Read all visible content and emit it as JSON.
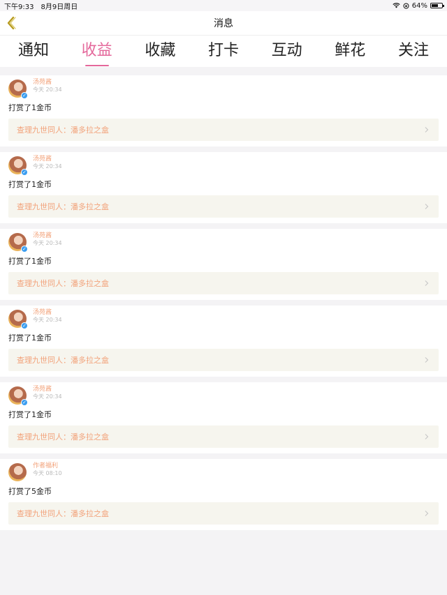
{
  "status": {
    "time": "下午9:33",
    "date": "8月9日周日",
    "battery": "64%",
    "battery_level": 0.64
  },
  "header": {
    "title": "消息",
    "back_icon": "chevron-left-icon"
  },
  "tabs": [
    {
      "label": "通知",
      "active": false
    },
    {
      "label": "收益",
      "active": true
    },
    {
      "label": "收藏",
      "active": false
    },
    {
      "label": "打卡",
      "active": false
    },
    {
      "label": "互动",
      "active": false
    },
    {
      "label": "鲜花",
      "active": false
    },
    {
      "label": "关注",
      "active": false
    }
  ],
  "colors": {
    "accent": "#e4689b",
    "name": "#f2a27a",
    "link_bg": "#f6f5ee",
    "verified": "#3a9df0"
  },
  "items": [
    {
      "name": "汤苑酱",
      "time": "今天 20:34",
      "message": "打赏了1金币",
      "link": "查理九世同人：潘多拉之盒",
      "verified": true
    },
    {
      "name": "汤苑酱",
      "time": "今天 20:34",
      "message": "打赏了1金币",
      "link": "查理九世同人：潘多拉之盒",
      "verified": true
    },
    {
      "name": "汤苑酱",
      "time": "今天 20:34",
      "message": "打赏了1金币",
      "link": "查理九世同人：潘多拉之盒",
      "verified": true
    },
    {
      "name": "汤苑酱",
      "time": "今天 20:34",
      "message": "打赏了1金币",
      "link": "查理九世同人：潘多拉之盒",
      "verified": true
    },
    {
      "name": "汤苑酱",
      "time": "今天 20:34",
      "message": "打赏了1金币",
      "link": "查理九世同人：潘多拉之盒",
      "verified": true
    },
    {
      "name": "作者福利",
      "time": "今天 08:10",
      "message": "打赏了5金币",
      "link": "查理九世同人：潘多拉之盒",
      "verified": false
    }
  ]
}
